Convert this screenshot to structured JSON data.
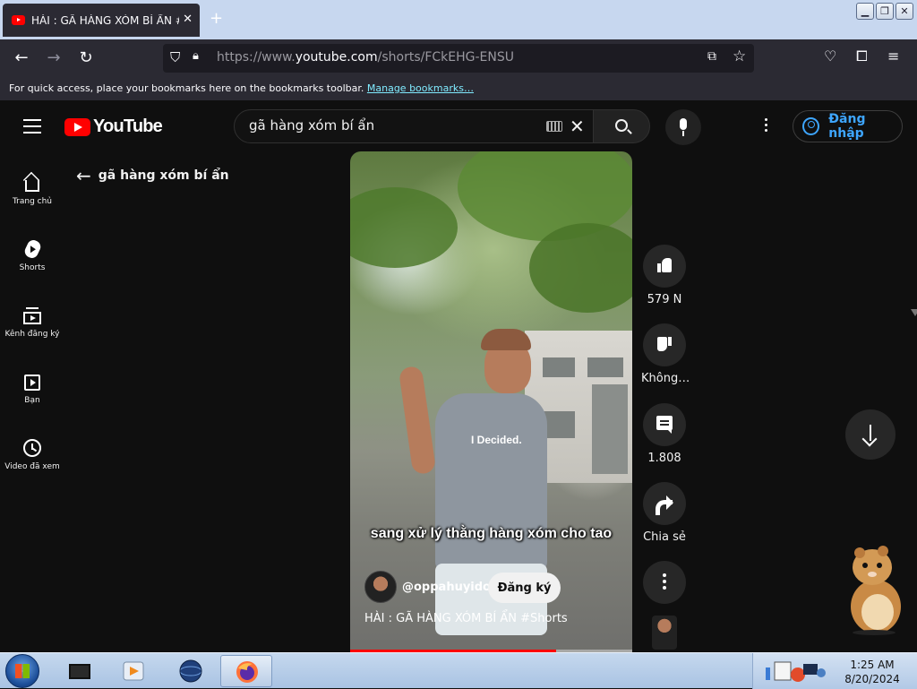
{
  "browser": {
    "tab_title": "HÀI : GÃ HÀNG XÓM BÍ ẨN #Shorts",
    "new_tab": "+",
    "url_prefix": "https://www.",
    "url_domain": "youtube.com",
    "url_path": "/shorts/FCkEHG-ENSU",
    "bookmarks_message": "For quick access, place your bookmarks here on the bookmarks toolbar.",
    "manage_bookmarks": "Manage bookmarks…"
  },
  "youtube": {
    "logo_text": "YouTube",
    "search_value": "gã hàng xóm bí ẩn",
    "sign_in": "Đăng nhập",
    "back_label": "gã hàng xóm bí ẩn",
    "nav": [
      {
        "label": "Trang chủ",
        "icon": "home-icon"
      },
      {
        "label": "Shorts",
        "icon": "shorts-icon"
      },
      {
        "label": "Kênh đăng ký",
        "icon": "subscriptions-icon"
      },
      {
        "label": "Bạn",
        "icon": "you-icon"
      },
      {
        "label": "Video đã xem",
        "icon": "history-icon"
      }
    ]
  },
  "short": {
    "caption": "sang xử lý thằng hàng xóm cho tao",
    "shirt_text": "I Decided.",
    "channel": "@oppahuyidol",
    "subscribe": "Đăng ký",
    "title": "HÀI : GÃ HÀNG XÓM BÍ ẨN #Shorts",
    "progress": 0.73,
    "likes": "579 N",
    "dislike_label": "Không…",
    "comments": "1.808",
    "share_label": "Chia sẻ"
  },
  "taskbar": {
    "time": "1:25 AM",
    "date": "8/20/2024"
  }
}
